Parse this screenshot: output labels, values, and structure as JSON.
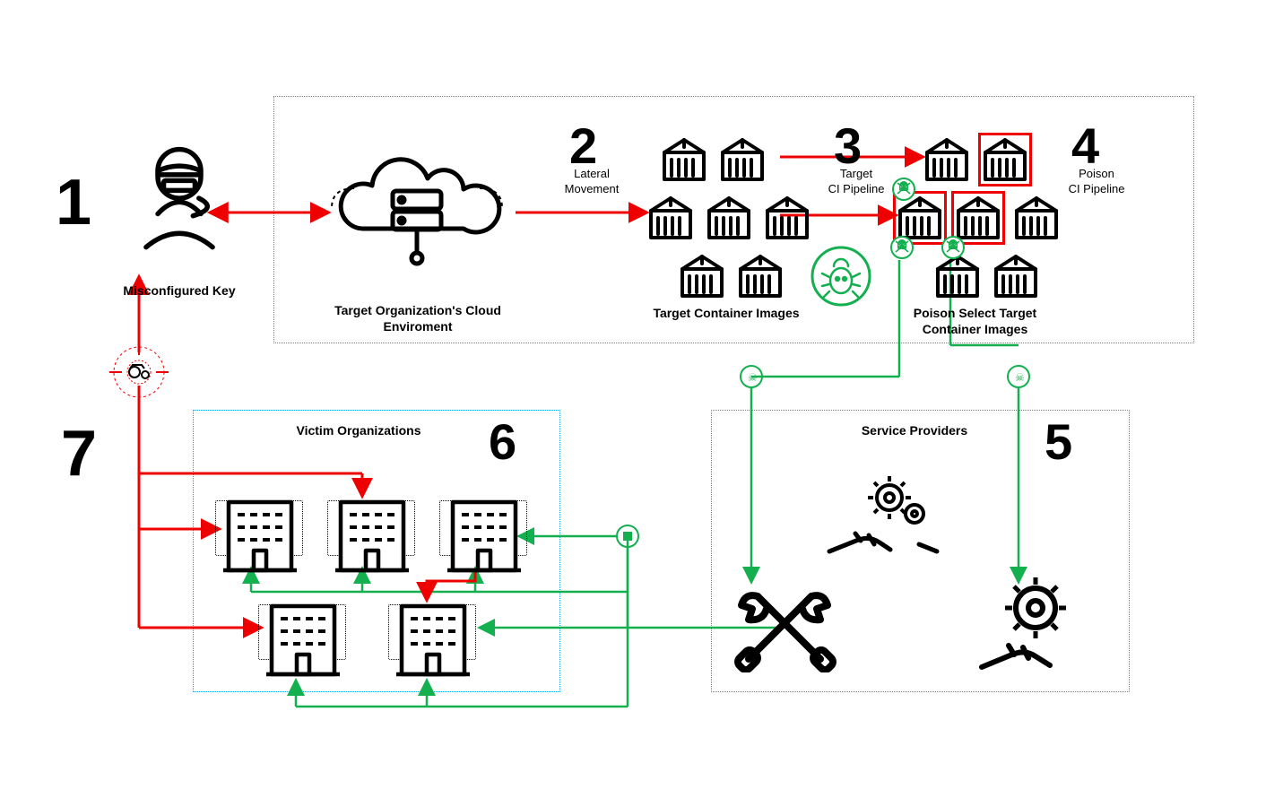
{
  "steps": {
    "s1": {
      "num": "1",
      "label": "Misconfigured Key"
    },
    "s2": {
      "num": "2",
      "label": "Lateral\nMovement"
    },
    "s3": {
      "num": "3",
      "label": "Target\nCI Pipeline"
    },
    "s4": {
      "num": "4",
      "label": "Poison\nCI Pipeline"
    },
    "s5": {
      "num": "5",
      "label": "Service Providers"
    },
    "s6": {
      "num": "6",
      "label": "Victim Organizations"
    },
    "s7": {
      "num": "7",
      "label": ""
    }
  },
  "actors": {
    "cloud": "Target Organization's Cloud\nEnviroment",
    "images": "Target Container Images",
    "poison_images": "Poison Select Target\nContainer Images",
    "victims": "Victim Organizations",
    "providers": "Service Providers"
  }
}
